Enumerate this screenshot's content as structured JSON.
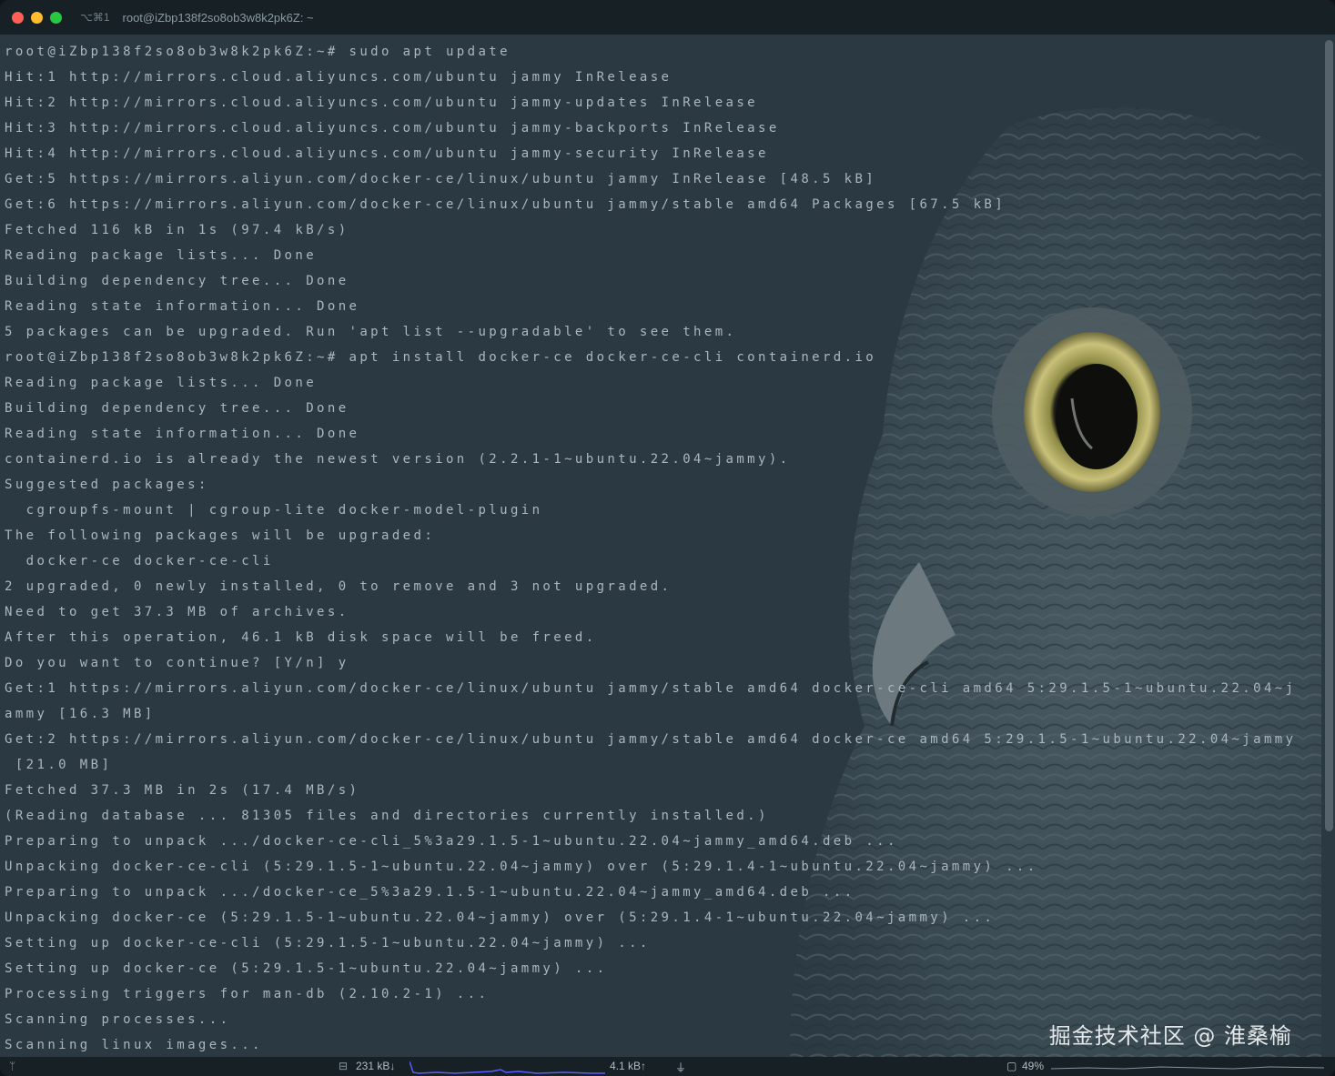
{
  "window": {
    "shortcut": "⌥⌘1",
    "title": "root@iZbp138f2so8ob3w8k2pk6Z: ~"
  },
  "terminal_lines": [
    "root@iZbp138f2so8ob3w8k2pk6Z:~# sudo apt update",
    "Hit:1 http://mirrors.cloud.aliyuncs.com/ubuntu jammy InRelease",
    "Hit:2 http://mirrors.cloud.aliyuncs.com/ubuntu jammy-updates InRelease",
    "Hit:3 http://mirrors.cloud.aliyuncs.com/ubuntu jammy-backports InRelease",
    "Hit:4 http://mirrors.cloud.aliyuncs.com/ubuntu jammy-security InRelease",
    "Get:5 https://mirrors.aliyun.com/docker-ce/linux/ubuntu jammy InRelease [48.5 kB]",
    "Get:6 https://mirrors.aliyun.com/docker-ce/linux/ubuntu jammy/stable amd64 Packages [67.5 kB]",
    "Fetched 116 kB in 1s (97.4 kB/s)",
    "Reading package lists... Done",
    "Building dependency tree... Done",
    "Reading state information... Done",
    "5 packages can be upgraded. Run 'apt list --upgradable' to see them.",
    "root@iZbp138f2so8ob3w8k2pk6Z:~# apt install docker-ce docker-ce-cli containerd.io",
    "Reading package lists... Done",
    "Building dependency tree... Done",
    "Reading state information... Done",
    "containerd.io is already the newest version (2.2.1-1~ubuntu.22.04~jammy).",
    "Suggested packages:",
    "  cgroupfs-mount | cgroup-lite docker-model-plugin",
    "The following packages will be upgraded:",
    "  docker-ce docker-ce-cli",
    "2 upgraded, 0 newly installed, 0 to remove and 3 not upgraded.",
    "Need to get 37.3 MB of archives.",
    "After this operation, 46.1 kB disk space will be freed.",
    "Do you want to continue? [Y/n] y",
    "Get:1 https://mirrors.aliyun.com/docker-ce/linux/ubuntu jammy/stable amd64 docker-ce-cli amd64 5:29.1.5-1~ubuntu.22.04~j",
    "ammy [16.3 MB]",
    "Get:2 https://mirrors.aliyun.com/docker-ce/linux/ubuntu jammy/stable amd64 docker-ce amd64 5:29.1.5-1~ubuntu.22.04~jammy",
    " [21.0 MB]",
    "Fetched 37.3 MB in 2s (17.4 MB/s)",
    "(Reading database ... 81305 files and directories currently installed.)",
    "Preparing to unpack .../docker-ce-cli_5%3a29.1.5-1~ubuntu.22.04~jammy_amd64.deb ...",
    "Unpacking docker-ce-cli (5:29.1.5-1~ubuntu.22.04~jammy) over (5:29.1.4-1~ubuntu.22.04~jammy) ...",
    "Preparing to unpack .../docker-ce_5%3a29.1.5-1~ubuntu.22.04~jammy_amd64.deb ...",
    "Unpacking docker-ce (5:29.1.5-1~ubuntu.22.04~jammy) over (5:29.1.4-1~ubuntu.22.04~jammy) ...",
    "Setting up docker-ce-cli (5:29.1.5-1~ubuntu.22.04~jammy) ...",
    "Setting up docker-ce (5:29.1.5-1~ubuntu.22.04~jammy) ...",
    "Processing triggers for man-db (2.10.2-1) ...",
    "Scanning processes...",
    "Scanning linux images..."
  ],
  "watermark": "掘金技术社区 @ 淮桑榆",
  "statusbar": {
    "branch_icon": "ᛘ",
    "network_icon": "⊟",
    "download_rate": "231 kB↓",
    "upload_rate": "4.1 kB↑",
    "power_icon": "⏚",
    "cpu_icon": "▢",
    "cpu_usage": "49%"
  },
  "colors": {
    "terminal_bg": "#2b3a42",
    "terminal_text": "#aab7bc",
    "graph_color": "#5b5bff",
    "titlebar_bg": "#172125"
  }
}
